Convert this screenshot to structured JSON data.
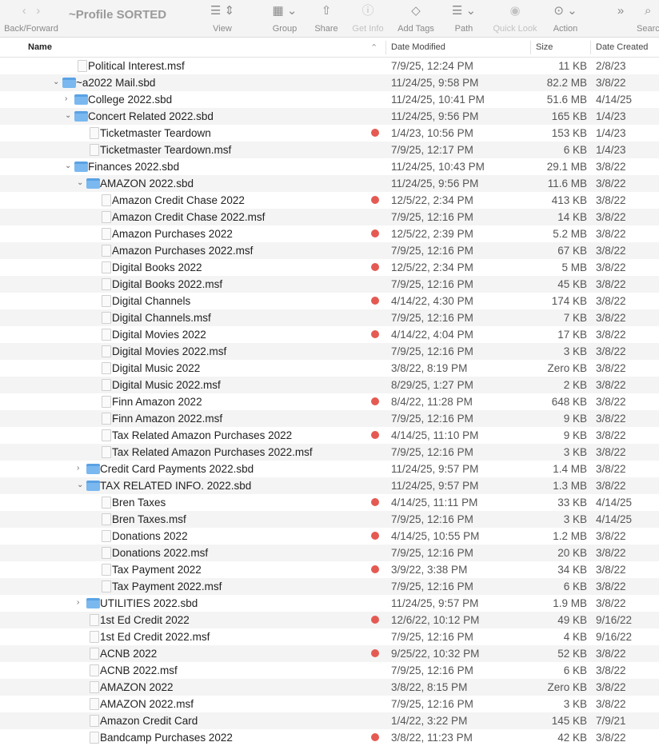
{
  "toolbar": {
    "title": "~Profile SORTED",
    "back_forward": "Back/Forward",
    "view": "View",
    "group": "Group",
    "share": "Share",
    "get_info": "Get Info",
    "add_tags": "Add Tags",
    "path": "Path",
    "quick_look": "Quick Look",
    "action": "Action",
    "search": "Search"
  },
  "columns": {
    "name": "Name",
    "date_modified": "Date Modified",
    "size": "Size",
    "date_created": "Date Created"
  },
  "colors": {
    "tag_red": "#e45a52",
    "folder": "#7ab8ef"
  },
  "rows": [
    {
      "name": "Political Interest.msf",
      "level": 2,
      "type": "file",
      "tag": false,
      "modified": "7/9/25, 12:24 PM",
      "size": "11 KB",
      "created": "2/8/23"
    },
    {
      "name": "~a2022 Mail.sbd",
      "level": 1,
      "type": "folder",
      "open": true,
      "tag": false,
      "modified": "11/24/25, 9:58 PM",
      "size": "82.2 MB",
      "created": "3/8/22"
    },
    {
      "name": "College 2022.sbd",
      "level": 2,
      "type": "folder",
      "open": false,
      "tag": false,
      "modified": "11/24/25, 10:41 PM",
      "size": "51.6 MB",
      "created": "4/14/25"
    },
    {
      "name": "Concert Related 2022.sbd",
      "level": 2,
      "type": "folder",
      "open": true,
      "tag": false,
      "modified": "11/24/25, 9:56 PM",
      "size": "165 KB",
      "created": "1/4/23"
    },
    {
      "name": "Ticketmaster Teardown",
      "level": 3,
      "type": "file",
      "tag": true,
      "modified": "1/4/23, 10:56 PM",
      "size": "153 KB",
      "created": "1/4/23"
    },
    {
      "name": "Ticketmaster Teardown.msf",
      "level": 3,
      "type": "file",
      "tag": false,
      "modified": "7/9/25, 12:17 PM",
      "size": "6 KB",
      "created": "1/4/23"
    },
    {
      "name": "Finances 2022.sbd",
      "level": 2,
      "type": "folder",
      "open": true,
      "tag": false,
      "modified": "11/24/25, 10:43 PM",
      "size": "29.1 MB",
      "created": "3/8/22"
    },
    {
      "name": "AMAZON 2022.sbd",
      "level": 3,
      "type": "folder",
      "open": true,
      "tag": false,
      "modified": "11/24/25, 9:56 PM",
      "size": "11.6 MB",
      "created": "3/8/22"
    },
    {
      "name": "Amazon Credit Chase 2022",
      "level": 4,
      "type": "file",
      "tag": true,
      "modified": "12/5/22, 2:34 PM",
      "size": "413 KB",
      "created": "3/8/22"
    },
    {
      "name": "Amazon Credit Chase 2022.msf",
      "level": 4,
      "type": "file",
      "tag": false,
      "modified": "7/9/25, 12:16 PM",
      "size": "14 KB",
      "created": "3/8/22"
    },
    {
      "name": "Amazon Purchases 2022",
      "level": 4,
      "type": "file",
      "tag": true,
      "modified": "12/5/22, 2:39 PM",
      "size": "5.2 MB",
      "created": "3/8/22"
    },
    {
      "name": "Amazon Purchases 2022.msf",
      "level": 4,
      "type": "file",
      "tag": false,
      "modified": "7/9/25, 12:16 PM",
      "size": "67 KB",
      "created": "3/8/22"
    },
    {
      "name": "Digital Books 2022",
      "level": 4,
      "type": "file",
      "tag": true,
      "modified": "12/5/22, 2:34 PM",
      "size": "5 MB",
      "created": "3/8/22"
    },
    {
      "name": "Digital Books 2022.msf",
      "level": 4,
      "type": "file",
      "tag": false,
      "modified": "7/9/25, 12:16 PM",
      "size": "45 KB",
      "created": "3/8/22"
    },
    {
      "name": "Digital Channels",
      "level": 4,
      "type": "file",
      "tag": true,
      "modified": "4/14/22, 4:30 PM",
      "size": "174 KB",
      "created": "3/8/22"
    },
    {
      "name": "Digital Channels.msf",
      "level": 4,
      "type": "file",
      "tag": false,
      "modified": "7/9/25, 12:16 PM",
      "size": "7 KB",
      "created": "3/8/22"
    },
    {
      "name": "Digital Movies 2022",
      "level": 4,
      "type": "file",
      "tag": true,
      "modified": "4/14/22, 4:04 PM",
      "size": "17 KB",
      "created": "3/8/22"
    },
    {
      "name": "Digital Movies 2022.msf",
      "level": 4,
      "type": "file",
      "tag": false,
      "modified": "7/9/25, 12:16 PM",
      "size": "3 KB",
      "created": "3/8/22"
    },
    {
      "name": "Digital Music 2022",
      "level": 4,
      "type": "file",
      "tag": false,
      "modified": "3/8/22, 8:19 PM",
      "size": "Zero KB",
      "created": "3/8/22"
    },
    {
      "name": "Digital Music 2022.msf",
      "level": 4,
      "type": "file",
      "tag": false,
      "modified": "8/29/25, 1:27 PM",
      "size": "2 KB",
      "created": "3/8/22"
    },
    {
      "name": "Finn Amazon 2022",
      "level": 4,
      "type": "file",
      "tag": true,
      "modified": "8/4/22, 11:28 PM",
      "size": "648 KB",
      "created": "3/8/22"
    },
    {
      "name": "Finn Amazon 2022.msf",
      "level": 4,
      "type": "file",
      "tag": false,
      "modified": "7/9/25, 12:16 PM",
      "size": "9 KB",
      "created": "3/8/22"
    },
    {
      "name": "Tax Related Amazon Purchases 2022",
      "level": 4,
      "type": "file",
      "tag": true,
      "modified": "4/14/25, 11:10 PM",
      "size": "9 KB",
      "created": "3/8/22"
    },
    {
      "name": "Tax Related Amazon Purchases 2022.msf",
      "level": 4,
      "type": "file",
      "tag": false,
      "modified": "7/9/25, 12:16 PM",
      "size": "3 KB",
      "created": "3/8/22"
    },
    {
      "name": "Credit Card Payments 2022.sbd",
      "level": 3,
      "type": "folder",
      "open": false,
      "tag": false,
      "modified": "11/24/25, 9:57 PM",
      "size": "1.4 MB",
      "created": "3/8/22"
    },
    {
      "name": "TAX RELATED INFO. 2022.sbd",
      "level": 3,
      "type": "folder",
      "open": true,
      "tag": false,
      "modified": "11/24/25, 9:57 PM",
      "size": "1.3 MB",
      "created": "3/8/22"
    },
    {
      "name": "Bren Taxes",
      "level": 4,
      "type": "file",
      "tag": true,
      "modified": "4/14/25, 11:11 PM",
      "size": "33 KB",
      "created": "4/14/25"
    },
    {
      "name": "Bren Taxes.msf",
      "level": 4,
      "type": "file",
      "tag": false,
      "modified": "7/9/25, 12:16 PM",
      "size": "3 KB",
      "created": "4/14/25"
    },
    {
      "name": "Donations 2022",
      "level": 4,
      "type": "file",
      "tag": true,
      "modified": "4/14/25, 10:55 PM",
      "size": "1.2 MB",
      "created": "3/8/22"
    },
    {
      "name": "Donations 2022.msf",
      "level": 4,
      "type": "file",
      "tag": false,
      "modified": "7/9/25, 12:16 PM",
      "size": "20 KB",
      "created": "3/8/22"
    },
    {
      "name": "Tax Payment 2022",
      "level": 4,
      "type": "file",
      "tag": true,
      "modified": "3/9/22, 3:38 PM",
      "size": "34 KB",
      "created": "3/8/22"
    },
    {
      "name": "Tax Payment 2022.msf",
      "level": 4,
      "type": "file",
      "tag": false,
      "modified": "7/9/25, 12:16 PM",
      "size": "6 KB",
      "created": "3/8/22"
    },
    {
      "name": "UTILITIES 2022.sbd",
      "level": 3,
      "type": "folder",
      "open": false,
      "tag": false,
      "modified": "11/24/25, 9:57 PM",
      "size": "1.9 MB",
      "created": "3/8/22"
    },
    {
      "name": "1st Ed Credit 2022",
      "level": 3,
      "type": "file",
      "tag": true,
      "modified": "12/6/22, 10:12 PM",
      "size": "49 KB",
      "created": "9/16/22"
    },
    {
      "name": "1st Ed Credit 2022.msf",
      "level": 3,
      "type": "file",
      "tag": false,
      "modified": "7/9/25, 12:16 PM",
      "size": "4 KB",
      "created": "9/16/22"
    },
    {
      "name": "ACNB 2022",
      "level": 3,
      "type": "file",
      "tag": true,
      "modified": "9/25/22, 10:32 PM",
      "size": "52 KB",
      "created": "3/8/22"
    },
    {
      "name": "ACNB 2022.msf",
      "level": 3,
      "type": "file",
      "tag": false,
      "modified": "7/9/25, 12:16 PM",
      "size": "6 KB",
      "created": "3/8/22"
    },
    {
      "name": "AMAZON 2022",
      "level": 3,
      "type": "file",
      "tag": false,
      "modified": "3/8/22, 8:15 PM",
      "size": "Zero KB",
      "created": "3/8/22"
    },
    {
      "name": "AMAZON 2022.msf",
      "level": 3,
      "type": "file",
      "tag": false,
      "modified": "7/9/25, 12:16 PM",
      "size": "3 KB",
      "created": "3/8/22"
    },
    {
      "name": "Amazon Credit Card",
      "level": 3,
      "type": "file",
      "tag": false,
      "modified": "1/4/22, 3:22 PM",
      "size": "145 KB",
      "created": "7/9/21"
    },
    {
      "name": "Bandcamp Purchases 2022",
      "level": 3,
      "type": "file",
      "tag": true,
      "modified": "3/8/22, 11:23 PM",
      "size": "42 KB",
      "created": "3/8/22"
    }
  ]
}
